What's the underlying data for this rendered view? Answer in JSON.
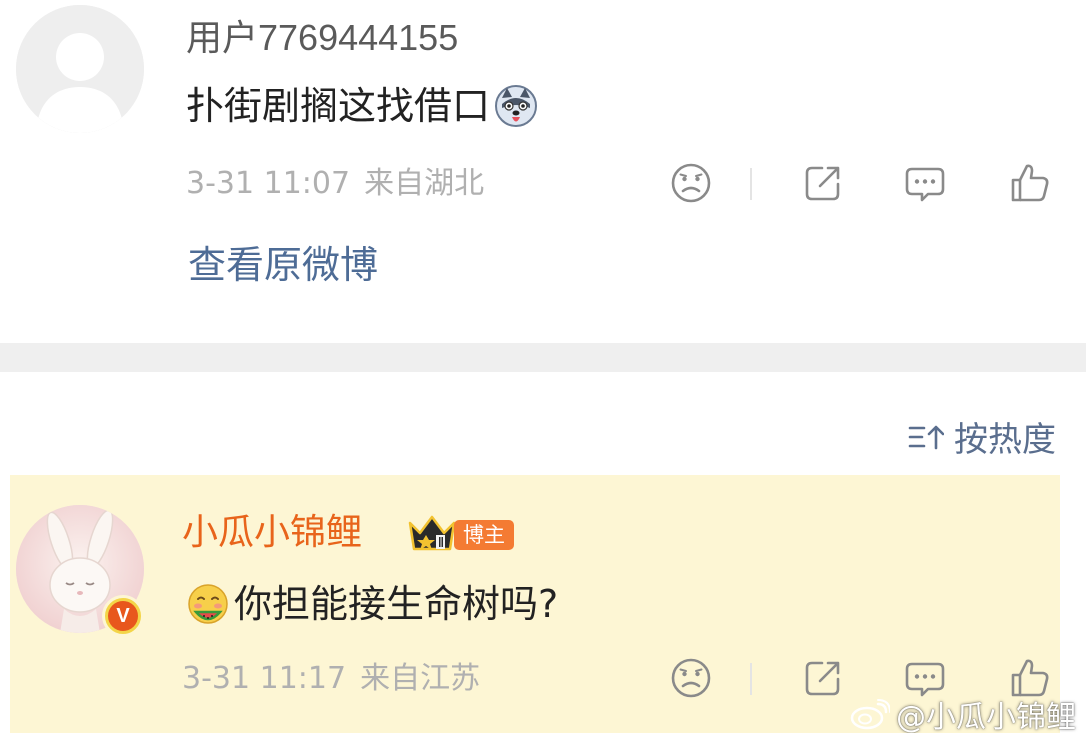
{
  "comment1": {
    "username": "用户7769444155",
    "text": "扑街剧搁这找借口",
    "time": "3-31 11:07",
    "location": "来自湖北",
    "view_original": "查看原微博",
    "avatar_icon": "default-user-avatar-icon",
    "emoji_icon": "husky-dog-emoji"
  },
  "sort": {
    "label": "按热度",
    "icon": "sort-hot-icon"
  },
  "comment2": {
    "username": "小瓜小锦鲤",
    "badge": "博主",
    "text": "你担能接生命树吗?",
    "time": "3-31 11:17",
    "location": "来自江苏",
    "avatar_icon": "bunny-avatar",
    "verified_badge": "V",
    "emoji_icon": "eating-watermelon-emoji",
    "highlight_color": "#fdf6d4",
    "name_color": "#e8641b"
  },
  "actions": {
    "icons": [
      "sad-face-icon",
      "share-icon",
      "comment-icon",
      "like-thumb-icon"
    ]
  },
  "watermark": {
    "text": "@小瓜小锦鲤",
    "icon": "weibo-logo-icon"
  },
  "colors": {
    "link": "#4e6c96",
    "meta": "#b0b0b0",
    "divider": "#efefef",
    "badge_bg": "#f47b33"
  }
}
